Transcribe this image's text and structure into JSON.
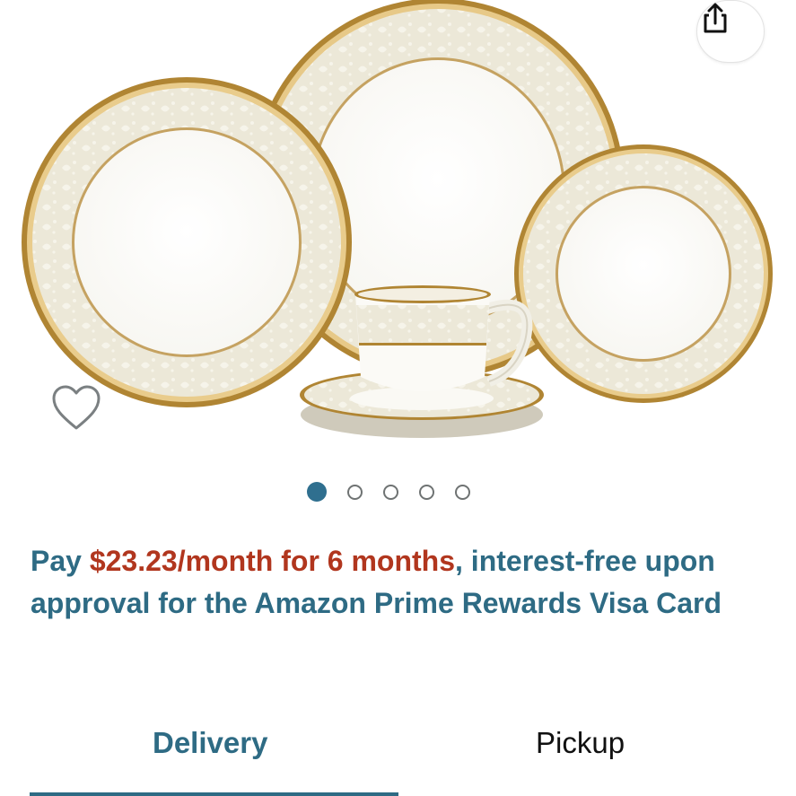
{
  "gallery": {
    "image_name": "dinnerware-place-setting-photo",
    "page_count": 5,
    "active_page": 1,
    "share_icon": "share-icon",
    "wishlist_icon": "heart-outline-icon"
  },
  "promo": {
    "prefix": "Pay ",
    "highlight": "$23.23/month for 6 months",
    "suffix": ", interest-free upon approval for the Amazon Prime Rewards Visa Card"
  },
  "tabs": {
    "delivery_label": "Delivery",
    "pickup_label": "Pickup",
    "selected": "Delivery"
  },
  "colors": {
    "accent": "#2e6b84",
    "highlight": "#b1361e",
    "gold": "#c79a3a"
  }
}
